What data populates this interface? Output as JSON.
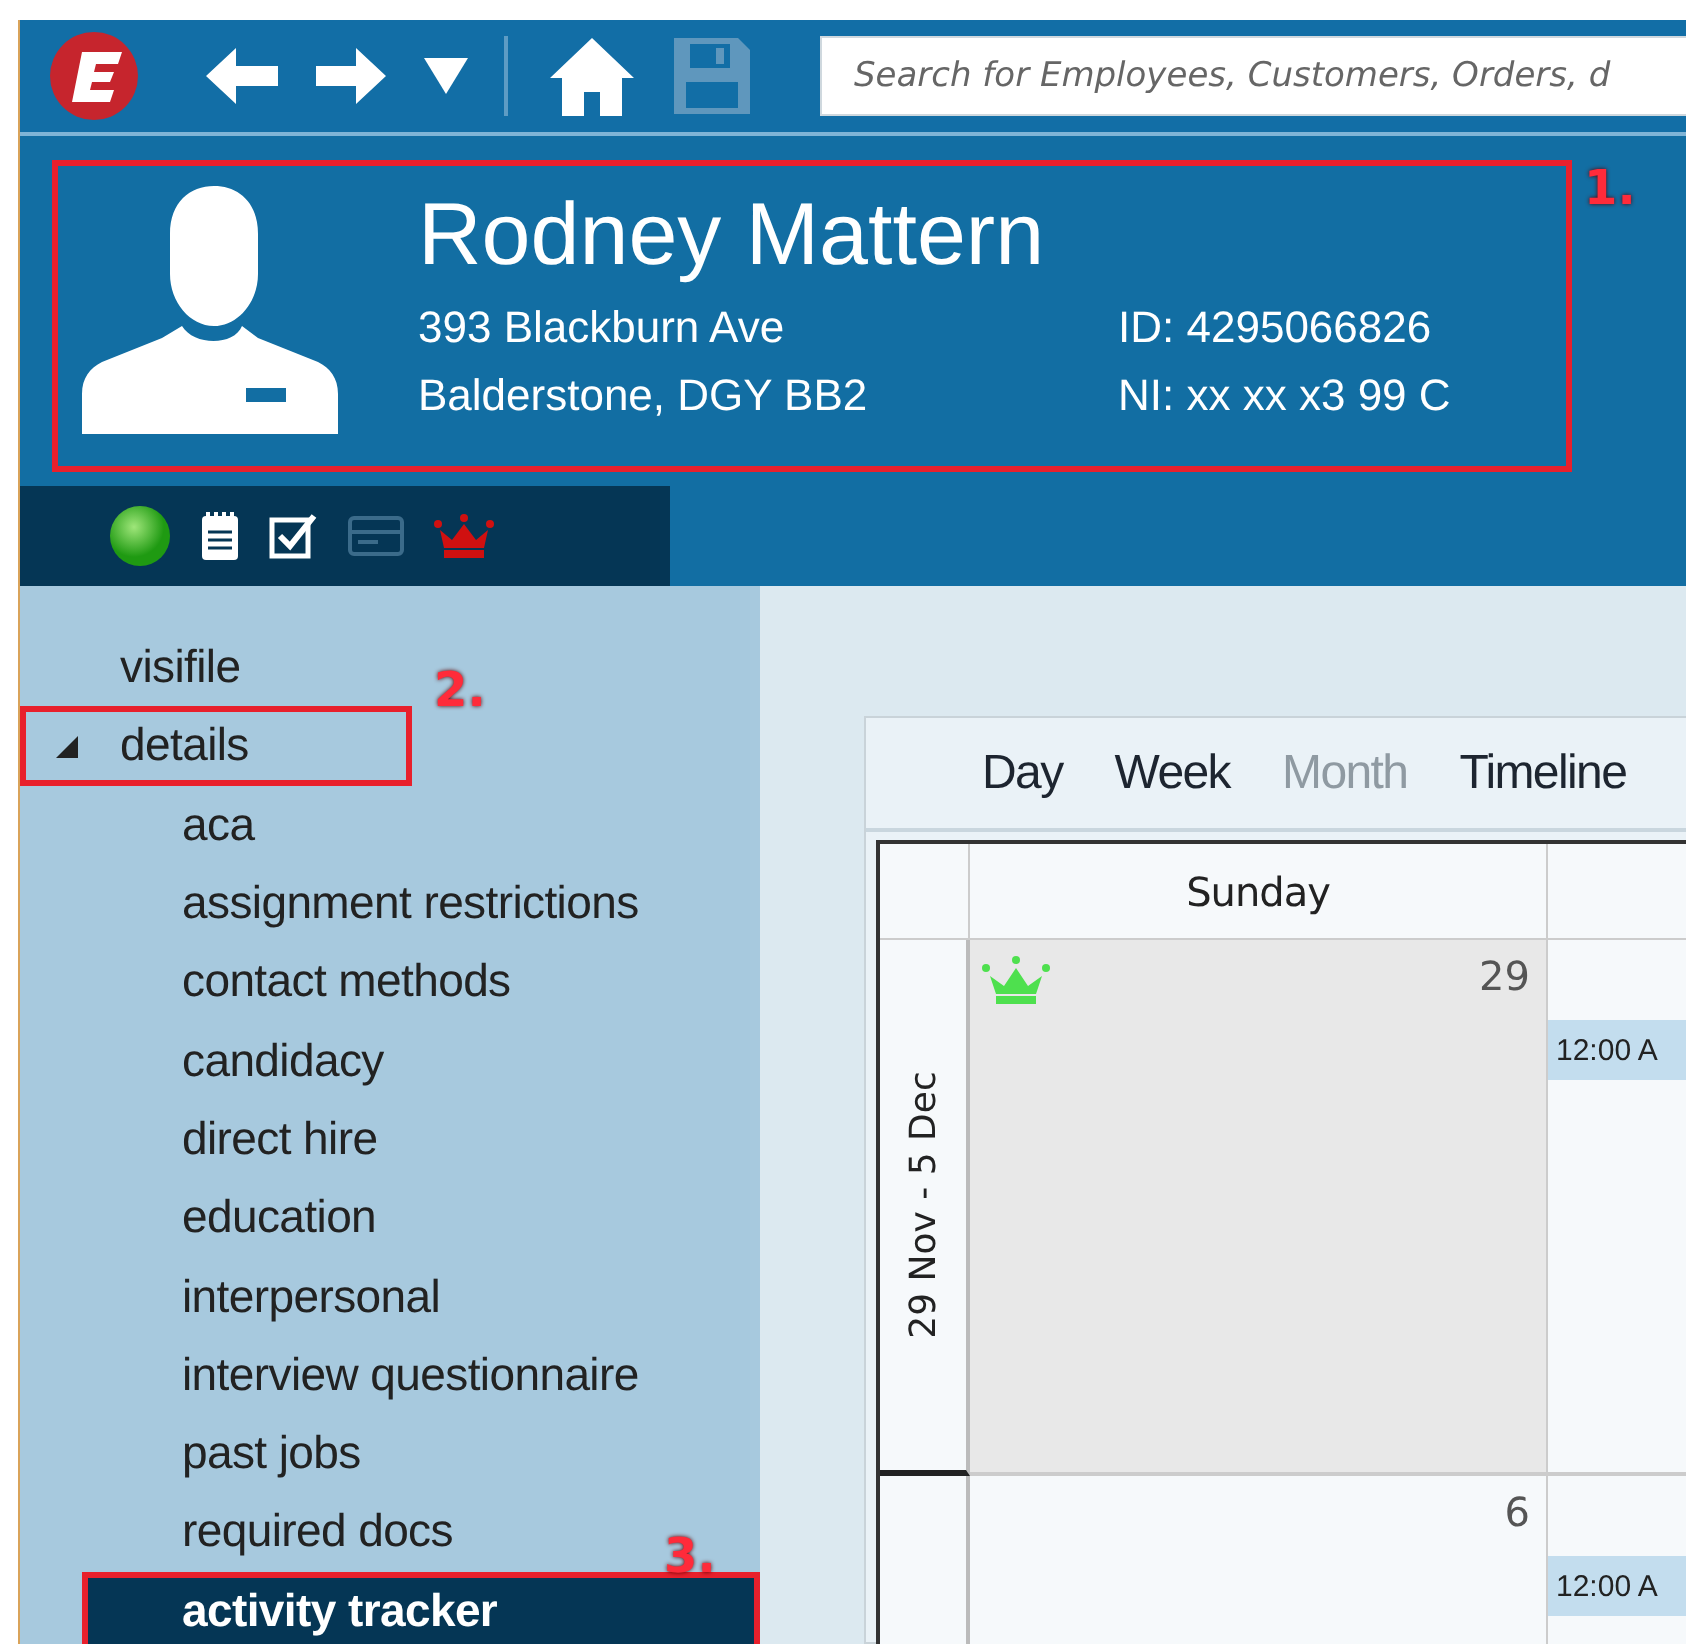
{
  "toolbar": {
    "search": {
      "placeholder": "Search for Employees, Customers, Orders, d"
    }
  },
  "profile": {
    "name": "Rodney Mattern",
    "address": [
      "393 Blackburn Ave",
      "Balderstone, DGY BB2"
    ],
    "id_label": "ID:",
    "id": "4295066826",
    "ni_label": "NI:",
    "ni": "xx xx x3 99 C",
    "callout": "1."
  },
  "status_icons": [
    {
      "kind": "dot"
    },
    {
      "kind": "notes"
    },
    {
      "kind": "check"
    },
    {
      "kind": "card"
    },
    {
      "kind": "crown"
    }
  ],
  "sidebar": {
    "items": [
      {
        "label": "visifile",
        "selected": false
      },
      {
        "label": "details",
        "selected": false,
        "expanded": true,
        "callout": "2.",
        "children": [
          {
            "label": "aca",
            "selected": false
          },
          {
            "label": "assignment restrictions",
            "selected": false
          },
          {
            "label": "contact methods",
            "selected": false
          },
          {
            "label": "candidacy",
            "selected": false
          },
          {
            "label": "direct hire",
            "selected": false
          },
          {
            "label": "education",
            "selected": false
          },
          {
            "label": "interpersonal",
            "selected": false
          },
          {
            "label": "interview questionnaire",
            "selected": false
          },
          {
            "label": "past jobs",
            "selected": false
          },
          {
            "label": "required docs",
            "selected": false
          },
          {
            "label": "activity tracker",
            "selected": true,
            "callout": "3."
          }
        ]
      }
    ]
  },
  "calendar": {
    "views": [
      {
        "label": "Day",
        "selected": false
      },
      {
        "label": "Week",
        "selected": false
      },
      {
        "label": "Month",
        "selected": true
      },
      {
        "label": "Timeline",
        "selected": false
      }
    ],
    "columns": [
      "Sunday"
    ],
    "weeks": [
      {
        "label": "29 Nov - 5 Dec",
        "date": "29",
        "shaded": true,
        "crown": true,
        "next_event": "12:00 A"
      },
      {
        "date": "6",
        "shaded": false,
        "crown": false,
        "next_event": "12:00 A"
      }
    ]
  }
}
